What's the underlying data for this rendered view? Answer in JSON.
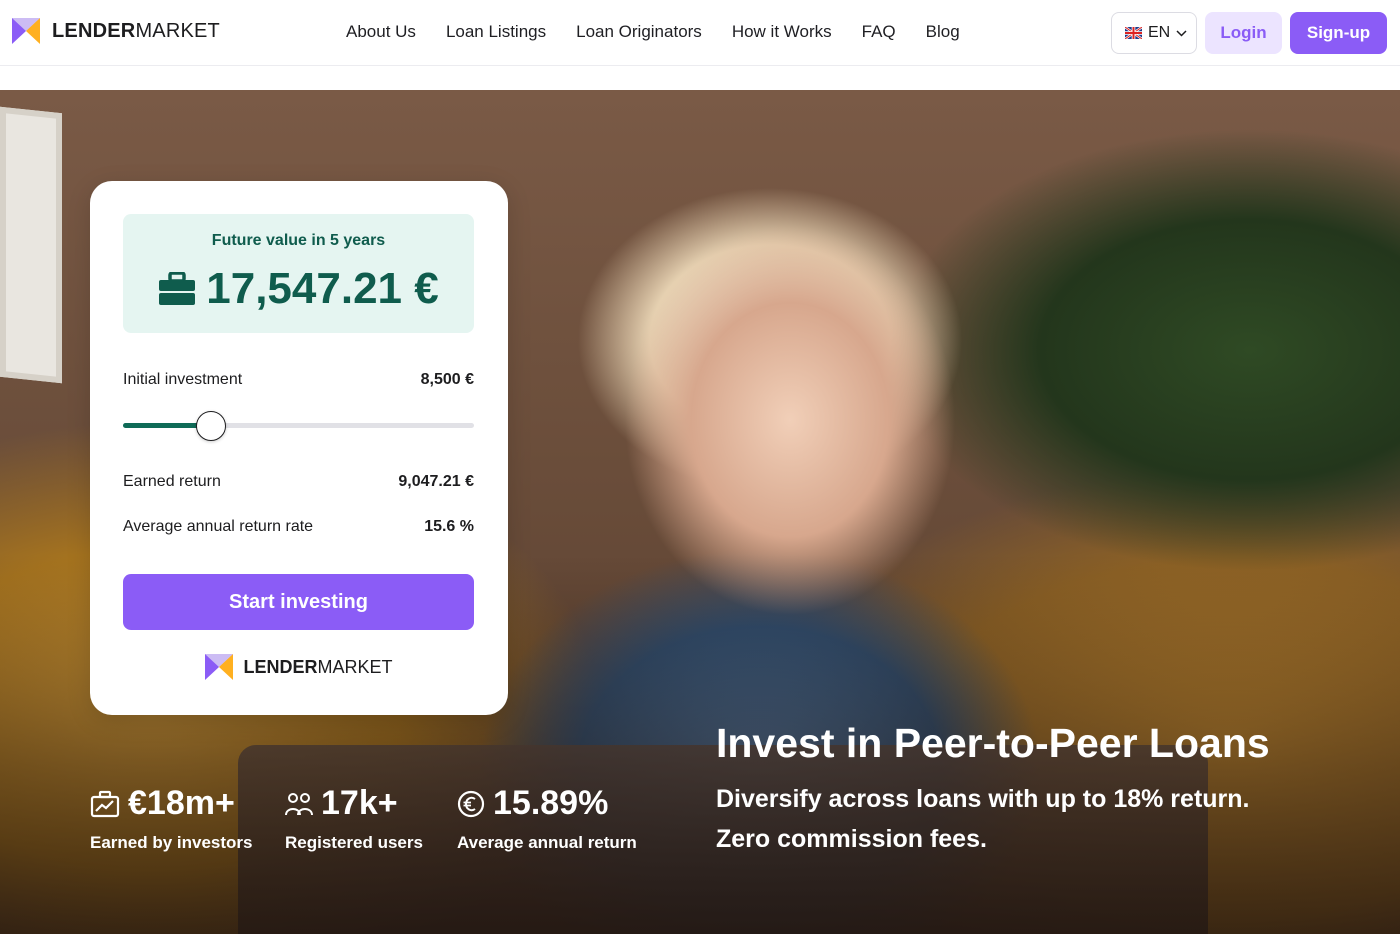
{
  "header": {
    "brand_bold": "LENDER",
    "brand_light": "MARKET",
    "nav": [
      "About Us",
      "Loan Listings",
      "Loan Originators",
      "How it Works",
      "FAQ",
      "Blog"
    ],
    "language": "EN",
    "login_label": "Login",
    "signup_label": "Sign-up"
  },
  "calculator": {
    "future_value_label": "Future value in 5 years",
    "future_value": "17,547.21 €",
    "initial_investment_label": "Initial investment",
    "initial_investment_value": "8,500 €",
    "slider_fraction": 0.25,
    "earned_return_label": "Earned return",
    "earned_return_value": "9,047.21 €",
    "avg_rate_label": "Average annual return rate",
    "avg_rate_value": "15.6 %",
    "cta_label": "Start investing",
    "brand_bold": "LENDER",
    "brand_light": "MARKET"
  },
  "stats": [
    {
      "icon": "chart-icon",
      "value": "€18m+",
      "label": "Earned by investors"
    },
    {
      "icon": "users-icon",
      "value": "17k+",
      "label": "Registered users"
    },
    {
      "icon": "euro-coin-icon",
      "value": "15.89%",
      "label": "Average annual return"
    }
  ],
  "hero": {
    "headline": "Invest in Peer-to-Peer Loans",
    "subline_1": "Diversify across loans with up to 18% return.",
    "subline_2": "Zero commission fees."
  },
  "colors": {
    "accent": "#8b5cf6",
    "accent_light": "#ece4ff",
    "teal": "#0f5c4d",
    "teal_bg": "#e5f5f1"
  }
}
